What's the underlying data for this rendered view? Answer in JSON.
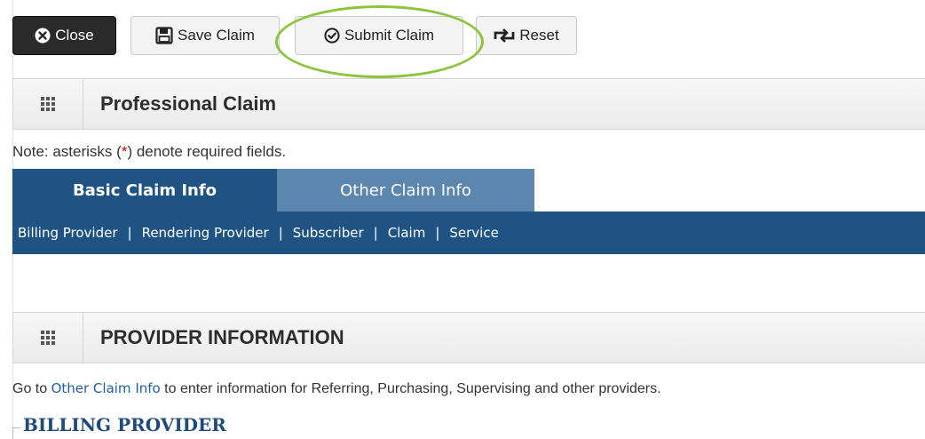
{
  "toolbar": {
    "close_label": "Close",
    "save_label": "Save Claim",
    "submit_label": "Submit Claim",
    "reset_label": "Reset"
  },
  "panel": {
    "title": "Professional Claim"
  },
  "note": {
    "prefix": "Note: asterisks (",
    "asterisk": "*",
    "suffix": ") denote required fields."
  },
  "tabs": [
    {
      "label": "Basic Claim Info",
      "active": true
    },
    {
      "label": "Other Claim Info",
      "active": false
    }
  ],
  "subnav": {
    "items": [
      "Billing Provider",
      "Rendering Provider",
      "Subscriber",
      "Claim",
      "Service"
    ],
    "separator": "|"
  },
  "provider_section": {
    "title": "PROVIDER INFORMATION",
    "goto_prefix": "Go to ",
    "goto_link": "Other Claim Info",
    "goto_suffix": " to enter information for Referring, Purchasing, Supervising and other providers.",
    "billing_title": "BILLING PROVIDER"
  },
  "colors": {
    "tab_active": "#1f5384",
    "tab_inactive": "#5b86ae",
    "highlight": "#8cc43c",
    "required": "#d00000"
  },
  "icons": [
    "close-circle-icon",
    "save-disk-icon",
    "check-circle-icon",
    "reset-arrows-icon",
    "grid-menu-icon"
  ]
}
